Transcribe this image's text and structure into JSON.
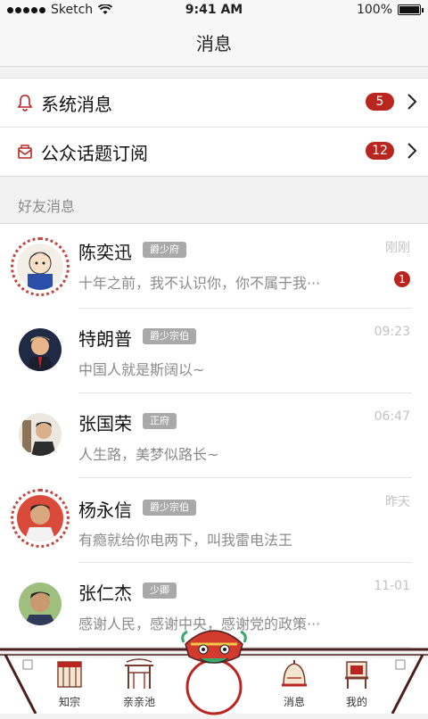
{
  "status_bar": {
    "carrier": "Sketch",
    "time": "9:41 AM",
    "battery": "100%"
  },
  "nav": {
    "title": "消息"
  },
  "system_items": [
    {
      "label": "系统消息",
      "badge": "5",
      "icon": "bell-icon"
    },
    {
      "label": "公众话题订阅",
      "badge": "12",
      "icon": "mail-icon"
    }
  ],
  "section_title": "好友消息",
  "friends": [
    {
      "name": "陈奕迅",
      "tag": "爵少府",
      "time": "刚刚",
      "message": "十年之前，我不认识你，你不属于我···",
      "unread": "1"
    },
    {
      "name": "特朗普",
      "tag": "爵少宗伯",
      "time": "09:23",
      "message": "中国人就是斯阔以~",
      "unread": ""
    },
    {
      "name": "张国荣",
      "tag": "正府",
      "time": "06:47",
      "message": "人生路，美梦似路长~",
      "unread": ""
    },
    {
      "name": "杨永信",
      "tag": "爵少宗伯",
      "time": "昨天",
      "message": "有瘾就给你电两下，叫我雷电法王",
      "unread": ""
    },
    {
      "name": "张仁杰",
      "tag": "少卿",
      "time": "11-01",
      "message": "感谢人民，感谢中央，感谢党的政策···",
      "unread": ""
    }
  ],
  "tabbar": {
    "tabs": [
      {
        "label": "知宗"
      },
      {
        "label": "亲亲池"
      },
      {
        "label": "消息"
      },
      {
        "label": "我的"
      }
    ]
  },
  "colors": {
    "accent": "#b9251f",
    "frame": "#4a1f1f"
  }
}
